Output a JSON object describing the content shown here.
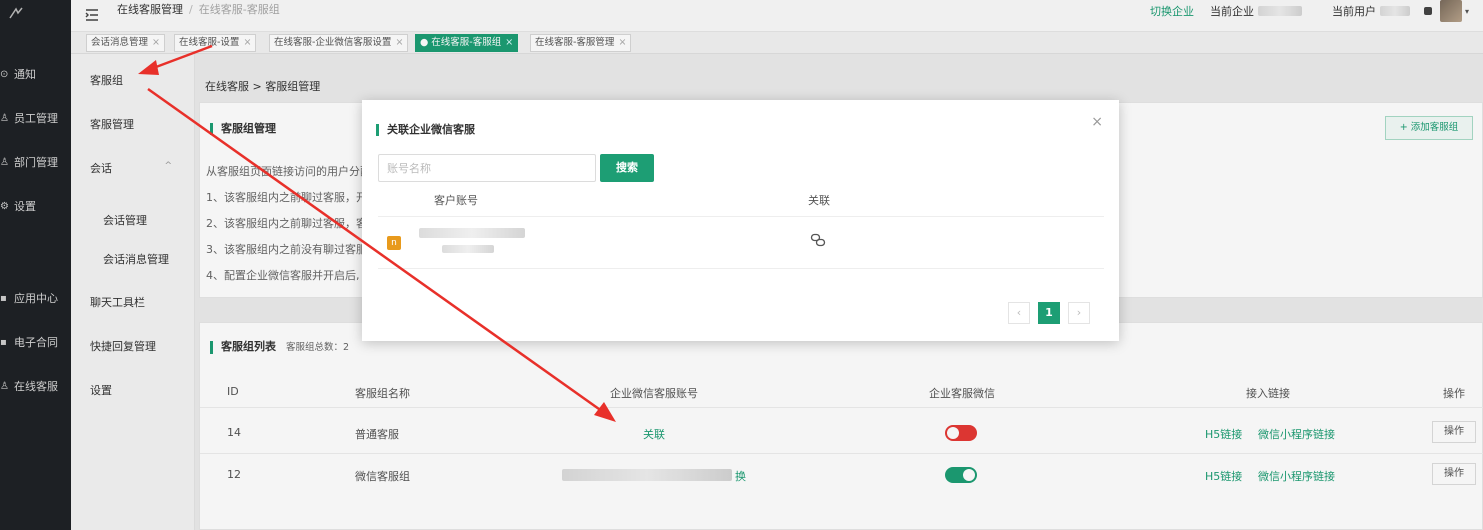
{
  "sidebar": {
    "items": [
      {
        "label": "通知",
        "icon": "bell-icon"
      },
      {
        "label": "员工管理",
        "icon": "user-icon"
      },
      {
        "label": "部门管理",
        "icon": "org-icon"
      },
      {
        "label": "设置",
        "icon": "gear-icon"
      },
      {
        "label": "应用中心",
        "icon": "apps-icon"
      },
      {
        "label": "电子合同",
        "icon": "contract-icon"
      },
      {
        "label": "在线客服",
        "icon": "service-icon"
      }
    ]
  },
  "header": {
    "breadcrumb_root": "在线客服管理",
    "breadcrumb_sep": "/",
    "breadcrumb_current": "在线客服-客服组",
    "switch_company": "切换企业",
    "current_company_label": "当前企业",
    "current_user_label": "当前用户"
  },
  "tabs": [
    {
      "label": "会话消息管理",
      "close": "×"
    },
    {
      "label": "在线客服-设置",
      "close": "×"
    },
    {
      "label": "在线客服-企业微信客服设置",
      "close": "×"
    },
    {
      "label": "● 在线客服-客服组",
      "close": "×",
      "active": true
    },
    {
      "label": "在线客服-客服管理",
      "close": "×"
    }
  ],
  "submenu": {
    "items": [
      "客服组",
      "客服管理",
      "会话",
      "会话管理",
      "会话消息管理",
      "聊天工具栏",
      "快捷回复管理",
      "设置"
    ],
    "chevron": "^"
  },
  "main": {
    "breadcrumb": "在线客服 > 客服组管理",
    "group_mgmt_title": "客服组管理",
    "add_button": "+ 添加客服组",
    "description_lines": [
      "从客服组页面链接访问的用户分配",
      "1、该客服组内之前聊过客服，开",
      "2、该客服组内之前聊过客服，客",
      "3、该客服组内之前没有聊过客服",
      "4、配置企业微信客服并开启后,"
    ],
    "list_title": "客服组列表",
    "count_label": "客服组总数：2",
    "columns": [
      "ID",
      "客服组名称",
      "企业微信客服账号",
      "企业客服微信",
      "接入链接",
      "操作"
    ],
    "rows": [
      {
        "id": "14",
        "name": "普通客服",
        "account": "关联",
        "wecom_enabled": false,
        "h5": "H5链接",
        "mini": "微信小程序链接",
        "op": "操作"
      },
      {
        "id": "12",
        "name": "微信客服组",
        "account": "换",
        "wecom_enabled": true,
        "h5": "H5链接",
        "mini": "微信小程序链接",
        "op": "操作"
      }
    ]
  },
  "modal": {
    "title": "关联企业微信客服",
    "close": "×",
    "search_placeholder": "账号名称",
    "search_button": "搜索",
    "columns": [
      "客户账号",
      "关联"
    ],
    "page_prev": "‹",
    "page_current": "1",
    "page_next": "›"
  },
  "colors": {
    "accent": "#1d9e74",
    "sidebar_bg": "#1f2226",
    "toggle_off": "#e53935",
    "annotation_arrow": "#e8302a"
  }
}
